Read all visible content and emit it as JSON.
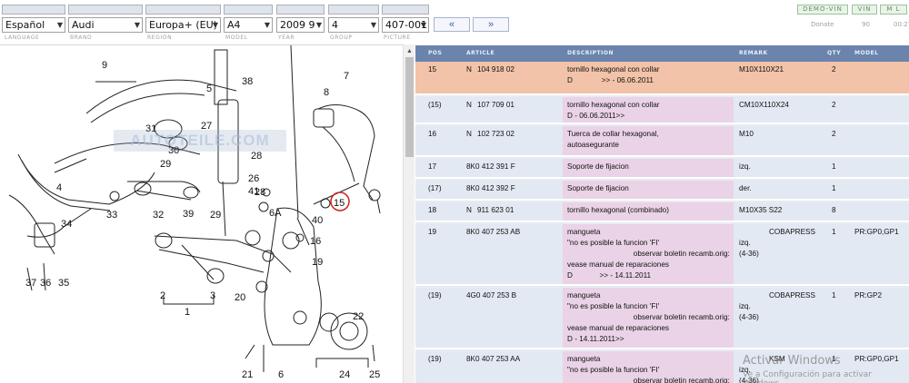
{
  "filters": {
    "language": "Español",
    "brand": "Audi",
    "region": "Europa+ (EU)",
    "model": "A4",
    "year": "2009",
    "year_index": "9",
    "group": "4",
    "picture": "407-001",
    "prev_label": "«",
    "next_label": "»",
    "labels": {
      "language": "LANGUAGE",
      "brand": "BRAND",
      "region": "REGION",
      "model": "MODEL",
      "year": "YEAR",
      "group": "GROUP",
      "picture": "PICTURE"
    }
  },
  "topright": {
    "demo": "DEMO-VIN",
    "vin": "VIN",
    "ml": "M L",
    "donate": "Donate",
    "n1": "90",
    "n2": "00:27"
  },
  "watermark": "AUTOTEILE.COM",
  "callouts": [
    "1",
    "2",
    "3",
    "4",
    "5",
    "6",
    "6A",
    "7",
    "8",
    "9",
    "15",
    "16",
    "19",
    "20",
    "21",
    "22",
    "24",
    "25",
    "26",
    "27",
    "28",
    "29",
    "30",
    "31",
    "32",
    "33",
    "34",
    "35",
    "36",
    "37",
    "38",
    "39",
    "40",
    "41"
  ],
  "table": {
    "headers": {
      "pos": "POS",
      "article": "ARTICLE",
      "description": "DESCRIPTION",
      "remark": "REMARK",
      "qty": "QTY",
      "model": "MODEL"
    },
    "rows": [
      {
        "pos": "15",
        "art_a": "N",
        "art_b": "104 918 02",
        "desc": [
          "tornillo hexagonal con collar",
          "D              >> - 06.06.2011"
        ],
        "remark": [
          "M10X110X21"
        ],
        "qty": "2",
        "model": "",
        "hl": true
      },
      {
        "pos": "(15)",
        "art_a": "N",
        "art_b": "107 709 01",
        "desc": [
          "tornillo hexagonal con collar",
          "D - 06.06.2011>>"
        ],
        "remark": [
          "CM10X110X24"
        ],
        "qty": "2",
        "model": ""
      },
      {
        "pos": "16",
        "art_a": "N",
        "art_b": "102 723 02",
        "desc": [
          "Tuerca de collar hexagonal,",
          "autoasegurante"
        ],
        "remark": [
          "M10"
        ],
        "qty": "2",
        "model": ""
      },
      {
        "pos": "17",
        "art_a": "8K0 412 391 F",
        "art_b": "",
        "desc": [
          "Soporte de fijacion"
        ],
        "remark": [
          "izq."
        ],
        "qty": "1",
        "model": ""
      },
      {
        "pos": "(17)",
        "art_a": "8K0 412 392 F",
        "art_b": "",
        "desc": [
          "Soporte de fijacion"
        ],
        "remark": [
          "der."
        ],
        "qty": "1",
        "model": ""
      },
      {
        "pos": "18",
        "art_a": "N",
        "art_b": "911 623 01",
        "desc": [
          "tornillo hexagonal (combinado)"
        ],
        "remark": [
          "M10X35 S22"
        ],
        "qty": "8",
        "model": ""
      },
      {
        "pos": "19",
        "art_a": "8K0 407 253 AB",
        "art_b": "",
        "desc": [
          "mangueta",
          "\"no es posible la funcion 'FI'",
          "                                observar boletin recamb.orig:",
          "vease manual de reparaciones",
          "D             >> - 14.11.2011"
        ],
        "remark": [
          "",
          "izq.",
          "(4-36)"
        ],
        "supplier": "COBAPRESS",
        "qty": "1",
        "model": "PR:GP0,GP1"
      },
      {
        "pos": "(19)",
        "art_a": "4G0 407 253 B",
        "art_b": "",
        "desc": [
          "mangueta",
          "\"no es posible la funcion 'FI'",
          "                                observar boletin recamb.orig:",
          "vease manual de reparaciones",
          "D - 14.11.2011>>"
        ],
        "remark": [
          "",
          "izq.",
          "(4-36)"
        ],
        "supplier": "COBAPRESS",
        "qty": "1",
        "model": "PR:GP2"
      },
      {
        "pos": "(19)",
        "art_a": "8K0 407 253 AA",
        "art_b": "",
        "desc": [
          "mangueta",
          "\"no es posible la funcion 'FI'",
          "                                observar boletin recamb.orig:"
        ],
        "remark": [
          "",
          "izq.",
          "(4-36)"
        ],
        "supplier": "KSM",
        "qty": "1",
        "model": "PR:GP0,GP1"
      }
    ]
  },
  "os_notice": {
    "line1": "Activar Windows",
    "line2": "Ve a Configuración para activar Windows."
  }
}
